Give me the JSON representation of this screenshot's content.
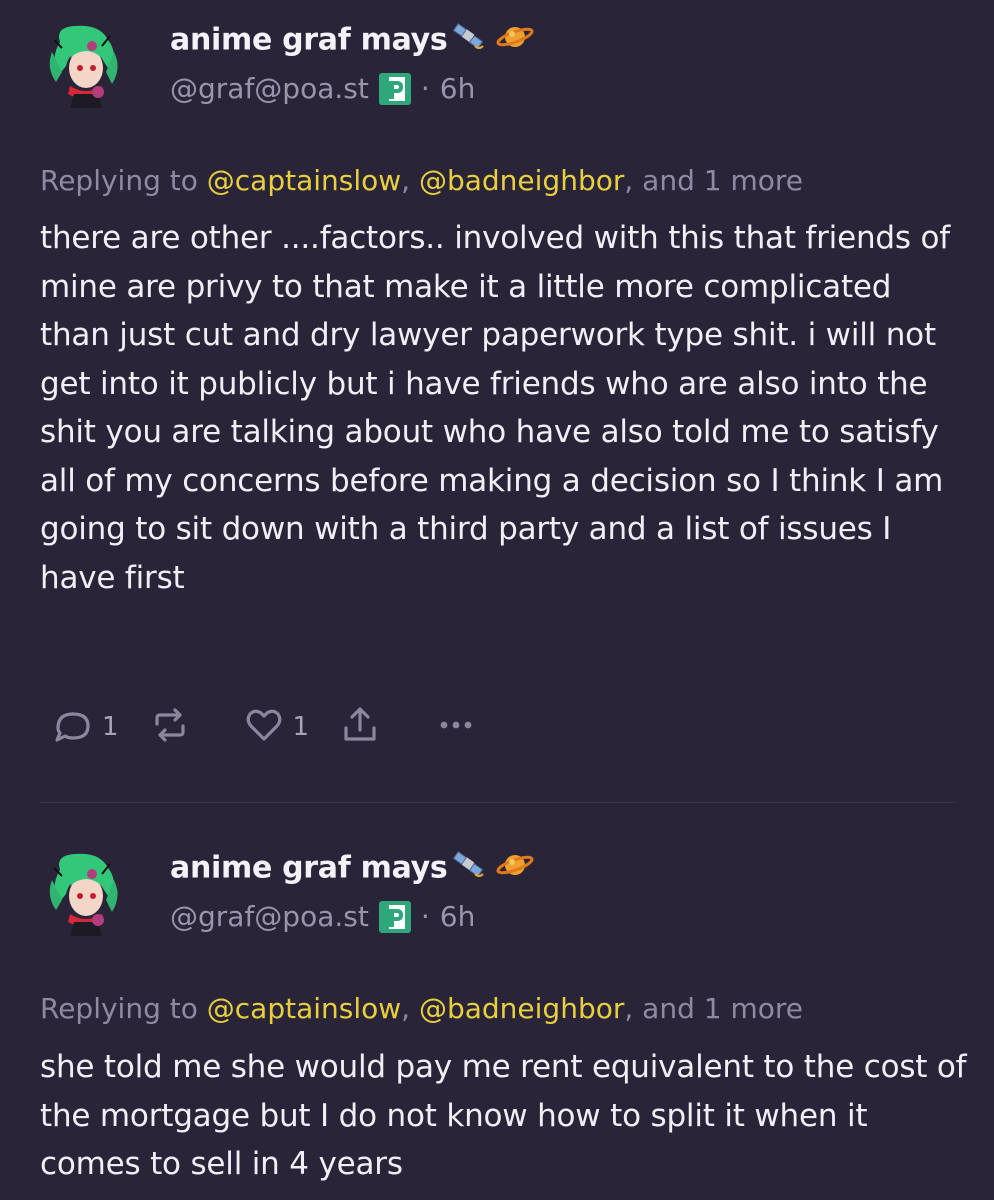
{
  "colors": {
    "background": "#2a2438",
    "mention": "#e8cf3e",
    "muted": "#8f8aa2",
    "text": "#f1eff6"
  },
  "posts": [
    {
      "display_name": "anime graf mays",
      "name_emojis": [
        "satellite-icon",
        "ringed-planet-icon"
      ],
      "handle": "@graf@poa.st",
      "instance_icon": "pleroma-p-icon",
      "separator": "·",
      "time": "6h",
      "replying_prefix": "Replying to",
      "mention_1": "@captainslow",
      "comma": ",",
      "mention_2": "@badneighbor",
      "and_more": ", and 1 more",
      "text": "there are other ....factors.. involved with this that friends of mine are privy to that make it a little more complicated than just cut and dry lawyer paperwork type shit. i will not get into it publicly but i have friends who are also into the shit you are talking about who have also told me to satisfy all of my concerns before making a decision so I think I am going to sit down with a third party and a list of issues I have first",
      "reply_count": "1",
      "like_count": "1"
    },
    {
      "display_name": "anime graf mays",
      "name_emojis": [
        "satellite-icon",
        "ringed-planet-icon"
      ],
      "handle": "@graf@poa.st",
      "instance_icon": "pleroma-p-icon",
      "separator": "·",
      "time": "6h",
      "replying_prefix": "Replying to",
      "mention_1": "@captainslow",
      "comma": ",",
      "mention_2": "@badneighbor",
      "and_more": ", and 1 more",
      "text": "she told me she would pay me rent equivalent to the cost of the mortgage but I do not know how to split it when it comes to sell in 4 years"
    }
  ]
}
